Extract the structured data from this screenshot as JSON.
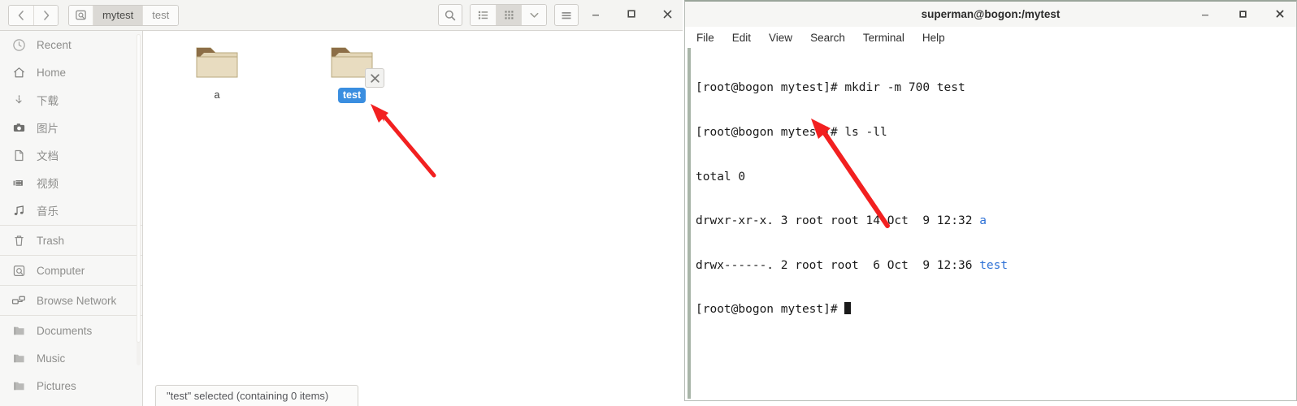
{
  "file_manager": {
    "nav": {
      "back_label": "Back",
      "forward_label": "Forward"
    },
    "breadcrumb": {
      "icon": "computer-icon",
      "items": [
        {
          "label": "mytest",
          "active": true
        },
        {
          "label": "test",
          "active": false
        }
      ]
    },
    "toolbar": {
      "search_label": "search-icon",
      "view_list_label": "list-view-icon",
      "view_grid_label": "grid-view-icon",
      "view_dropdown_label": "chevron-down-icon",
      "menu_label": "hamburger-menu-icon",
      "active_view": "grid"
    },
    "window_controls": {
      "minimize": "minimize-icon",
      "maximize": "maximize-icon",
      "close": "close-icon"
    },
    "sidebar": {
      "items": [
        {
          "label": "Recent",
          "icon": "clock-icon"
        },
        {
          "label": "Home",
          "icon": "home-icon"
        },
        {
          "label": "下载",
          "icon": "download-icon"
        },
        {
          "label": "图片",
          "icon": "camera-icon"
        },
        {
          "label": "文档",
          "icon": "document-icon"
        },
        {
          "label": "视频",
          "icon": "video-icon"
        },
        {
          "label": "音乐",
          "icon": "music-icon"
        },
        {
          "label": "Trash",
          "icon": "trash-icon"
        },
        {
          "label": "Computer",
          "icon": "computer-icon"
        },
        {
          "label": "Browse Network",
          "icon": "network-icon"
        },
        {
          "label": "Documents",
          "icon": "folder-icon"
        },
        {
          "label": "Music",
          "icon": "folder-icon"
        },
        {
          "label": "Pictures",
          "icon": "folder-icon"
        }
      ]
    },
    "files": [
      {
        "name": "a",
        "type": "folder",
        "selected": false,
        "emblem": null
      },
      {
        "name": "test",
        "type": "folder",
        "selected": true,
        "emblem": "unreadable-x-icon"
      }
    ],
    "status_text": "\"test\" selected (containing 0 items)",
    "colors": {
      "selection": "#3a8ee0",
      "folder_body": "#e0d3b4",
      "folder_tab": "#8c6e47"
    }
  },
  "terminal": {
    "title": "superman@bogon:/mytest",
    "menu": [
      "File",
      "Edit",
      "View",
      "Search",
      "Terminal",
      "Help"
    ],
    "window_controls": {
      "minimize": "minimize-icon",
      "maximize": "maximize-icon",
      "close": "close-icon"
    },
    "lines": [
      {
        "text": "[root@bogon mytest]# mkdir -m 700 test"
      },
      {
        "text": "[root@bogon mytest]# ls -ll"
      },
      {
        "text": "total 0"
      },
      {
        "text": "drwxr-xr-x. 3 root root 14 Oct  9 12:32 ",
        "dir": "a"
      },
      {
        "text": "drwx------. 2 root root  6 Oct  9 12:36 ",
        "dir": "test"
      },
      {
        "text": "[root@bogon mytest]# ",
        "cursor": true
      }
    ],
    "colors": {
      "dirname": "#2f72d6",
      "text": "#1a1a1a",
      "background": "#ffffff"
    }
  },
  "annotations": {
    "arrow_color": "#f22020",
    "arrows": [
      {
        "name": "arrow-to-test-folder",
        "target": "test folder icon"
      },
      {
        "name": "arrow-to-permissions",
        "target": "drwx------ permission string"
      }
    ]
  }
}
